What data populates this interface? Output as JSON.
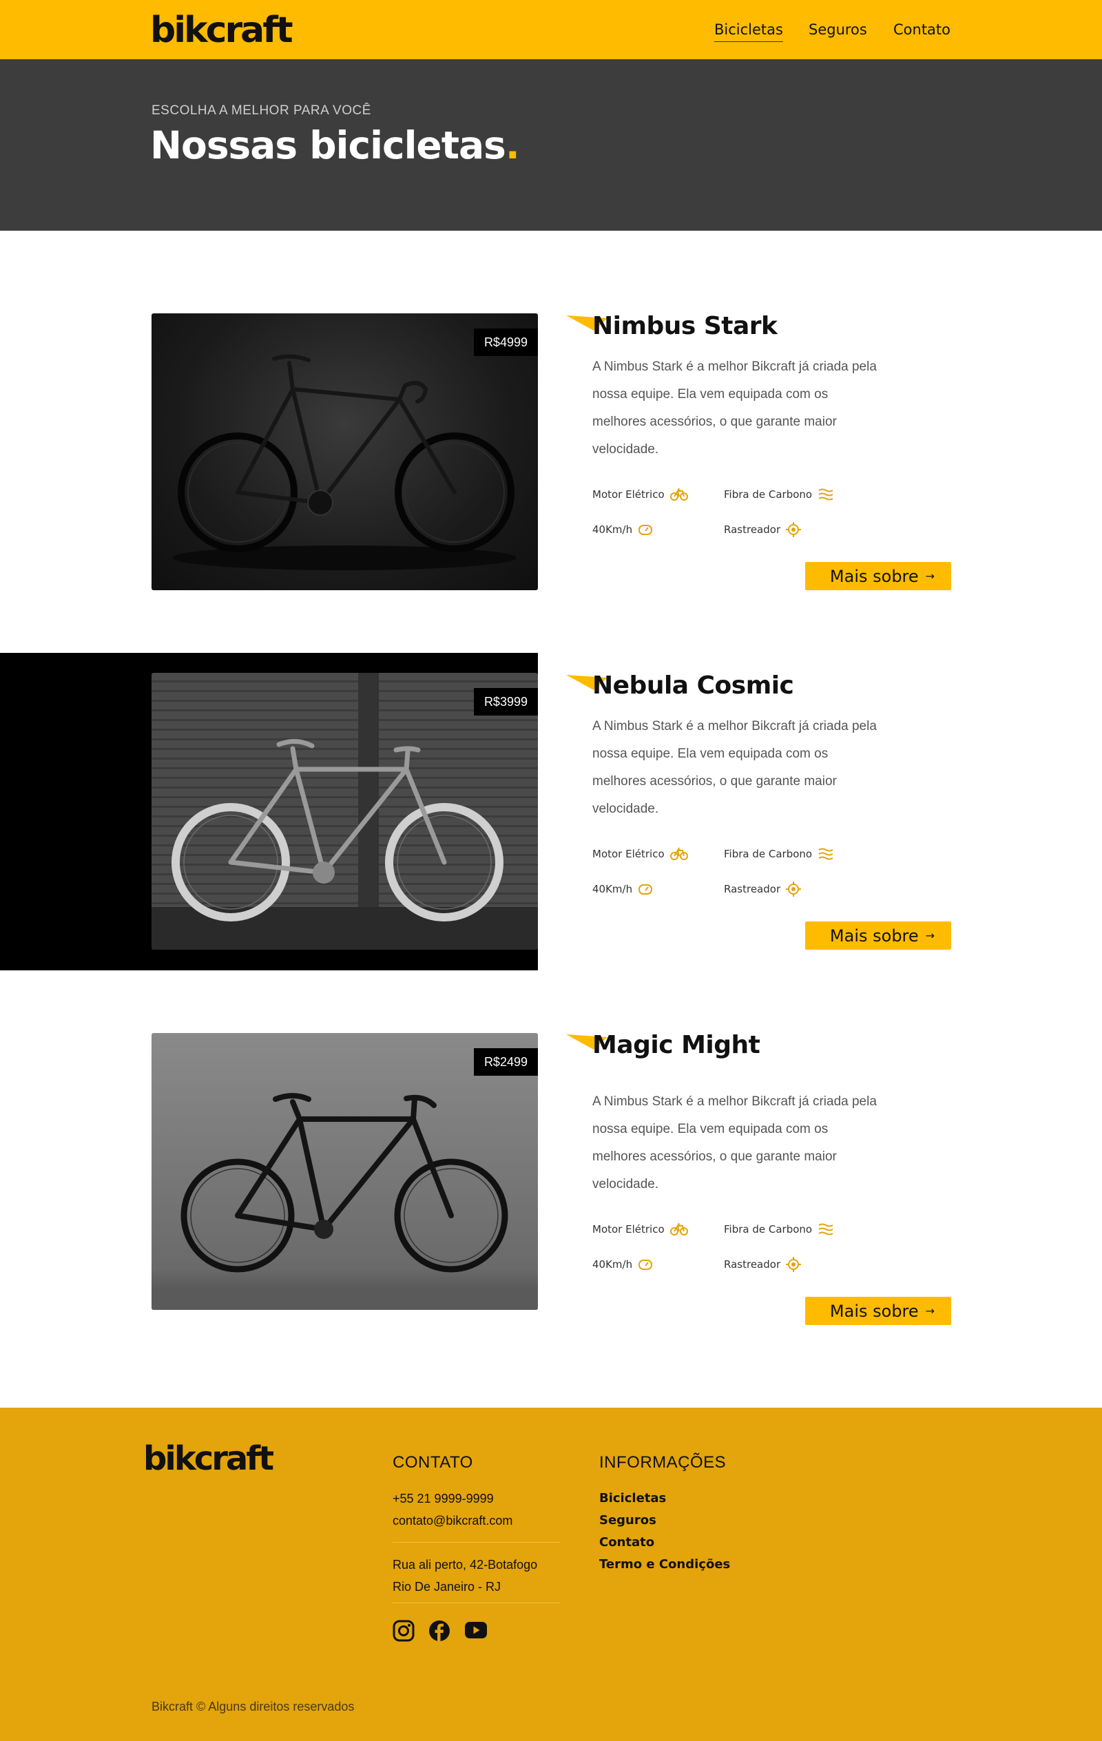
{
  "header": {
    "logo": "bikcraft",
    "nav": [
      "Bicicletas",
      "Seguros",
      "Contato"
    ],
    "active_nav": "Bicicletas"
  },
  "hero": {
    "eyebrow": "ESCOLHA A MELHOR PARA VOCÊ",
    "title": "Nossas bicicletas",
    "title_dot": "."
  },
  "products": [
    {
      "name": "Nimbus Stark",
      "price": "R$4999",
      "description": "A Nimbus Stark é a melhor Bikcraft já criada pela nossa equipe. Ela vem equipada com os melhores acessórios, o que garante maior velocidade.",
      "features": [
        "Motor Elétrico",
        "Fibra de Carbono",
        "40Km/h",
        "Rastreador"
      ],
      "button": "Mais sobre"
    },
    {
      "name": "Nebula Cosmic",
      "price": "R$3999",
      "description": "A Nimbus Stark é a melhor Bikcraft já criada pela nossa equipe. Ela vem equipada com os melhores acessórios, o que garante maior velocidade.",
      "features": [
        "Motor Elétrico",
        "Fibra de Carbono",
        "40Km/h",
        "Rastreador"
      ],
      "button": "Mais sobre"
    },
    {
      "name": "Magic Might",
      "price": "R$2499",
      "description": "A Nimbus Stark é a melhor Bikcraft já criada pela nossa equipe. Ela vem equipada com os melhores acessórios, o que garante maior velocidade.",
      "features": [
        "Motor Elétrico",
        "Fibra de Carbono",
        "40Km/h",
        "Rastreador"
      ],
      "button": "Mais sobre"
    }
  ],
  "footer": {
    "logo": "bikcraft",
    "contact_title": "CONTATO",
    "phone": "+55 21 9999-9999",
    "email": "contato@bikcraft.com",
    "address_line1": "Rua ali perto, 42-Botafogo",
    "address_line2": "Rio De Janeiro - RJ",
    "social_icons": [
      "instagram-icon",
      "facebook-icon",
      "youtube-icon"
    ],
    "info_title": "INFORMAÇÕES",
    "info_links": [
      "Bicicletas",
      "Seguros",
      "Contato",
      "Termo e Condições"
    ],
    "copyright": "Bikcraft © Alguns direitos reservados"
  },
  "colors": {
    "accent": "#FFBB00",
    "footer": "#E3A40C",
    "hero": "#3d3d3d"
  }
}
